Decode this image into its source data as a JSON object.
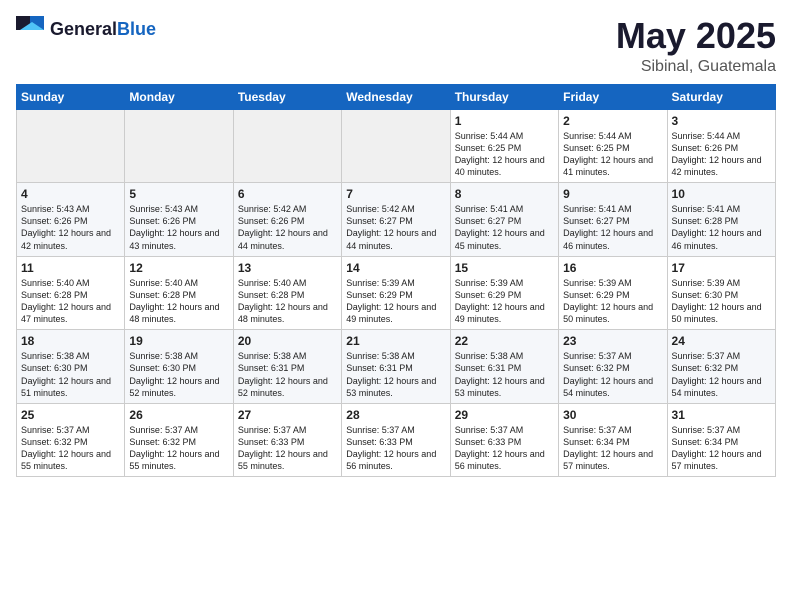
{
  "header": {
    "logo_general": "General",
    "logo_blue": "Blue",
    "month_title": "May 2025",
    "location": "Sibinal, Guatemala"
  },
  "weekdays": [
    "Sunday",
    "Monday",
    "Tuesday",
    "Wednesday",
    "Thursday",
    "Friday",
    "Saturday"
  ],
  "weeks": [
    [
      {
        "day": "",
        "sunrise": "",
        "sunset": "",
        "daylight": "",
        "empty": true
      },
      {
        "day": "",
        "sunrise": "",
        "sunset": "",
        "daylight": "",
        "empty": true
      },
      {
        "day": "",
        "sunrise": "",
        "sunset": "",
        "daylight": "",
        "empty": true
      },
      {
        "day": "",
        "sunrise": "",
        "sunset": "",
        "daylight": "",
        "empty": true
      },
      {
        "day": "1",
        "sunrise": "Sunrise: 5:44 AM",
        "sunset": "Sunset: 6:25 PM",
        "daylight": "Daylight: 12 hours and 40 minutes.",
        "empty": false
      },
      {
        "day": "2",
        "sunrise": "Sunrise: 5:44 AM",
        "sunset": "Sunset: 6:25 PM",
        "daylight": "Daylight: 12 hours and 41 minutes.",
        "empty": false
      },
      {
        "day": "3",
        "sunrise": "Sunrise: 5:44 AM",
        "sunset": "Sunset: 6:26 PM",
        "daylight": "Daylight: 12 hours and 42 minutes.",
        "empty": false
      }
    ],
    [
      {
        "day": "4",
        "sunrise": "Sunrise: 5:43 AM",
        "sunset": "Sunset: 6:26 PM",
        "daylight": "Daylight: 12 hours and 42 minutes.",
        "empty": false
      },
      {
        "day": "5",
        "sunrise": "Sunrise: 5:43 AM",
        "sunset": "Sunset: 6:26 PM",
        "daylight": "Daylight: 12 hours and 43 minutes.",
        "empty": false
      },
      {
        "day": "6",
        "sunrise": "Sunrise: 5:42 AM",
        "sunset": "Sunset: 6:26 PM",
        "daylight": "Daylight: 12 hours and 44 minutes.",
        "empty": false
      },
      {
        "day": "7",
        "sunrise": "Sunrise: 5:42 AM",
        "sunset": "Sunset: 6:27 PM",
        "daylight": "Daylight: 12 hours and 44 minutes.",
        "empty": false
      },
      {
        "day": "8",
        "sunrise": "Sunrise: 5:41 AM",
        "sunset": "Sunset: 6:27 PM",
        "daylight": "Daylight: 12 hours and 45 minutes.",
        "empty": false
      },
      {
        "day": "9",
        "sunrise": "Sunrise: 5:41 AM",
        "sunset": "Sunset: 6:27 PM",
        "daylight": "Daylight: 12 hours and 46 minutes.",
        "empty": false
      },
      {
        "day": "10",
        "sunrise": "Sunrise: 5:41 AM",
        "sunset": "Sunset: 6:28 PM",
        "daylight": "Daylight: 12 hours and 46 minutes.",
        "empty": false
      }
    ],
    [
      {
        "day": "11",
        "sunrise": "Sunrise: 5:40 AM",
        "sunset": "Sunset: 6:28 PM",
        "daylight": "Daylight: 12 hours and 47 minutes.",
        "empty": false
      },
      {
        "day": "12",
        "sunrise": "Sunrise: 5:40 AM",
        "sunset": "Sunset: 6:28 PM",
        "daylight": "Daylight: 12 hours and 48 minutes.",
        "empty": false
      },
      {
        "day": "13",
        "sunrise": "Sunrise: 5:40 AM",
        "sunset": "Sunset: 6:28 PM",
        "daylight": "Daylight: 12 hours and 48 minutes.",
        "empty": false
      },
      {
        "day": "14",
        "sunrise": "Sunrise: 5:39 AM",
        "sunset": "Sunset: 6:29 PM",
        "daylight": "Daylight: 12 hours and 49 minutes.",
        "empty": false
      },
      {
        "day": "15",
        "sunrise": "Sunrise: 5:39 AM",
        "sunset": "Sunset: 6:29 PM",
        "daylight": "Daylight: 12 hours and 49 minutes.",
        "empty": false
      },
      {
        "day": "16",
        "sunrise": "Sunrise: 5:39 AM",
        "sunset": "Sunset: 6:29 PM",
        "daylight": "Daylight: 12 hours and 50 minutes.",
        "empty": false
      },
      {
        "day": "17",
        "sunrise": "Sunrise: 5:39 AM",
        "sunset": "Sunset: 6:30 PM",
        "daylight": "Daylight: 12 hours and 50 minutes.",
        "empty": false
      }
    ],
    [
      {
        "day": "18",
        "sunrise": "Sunrise: 5:38 AM",
        "sunset": "Sunset: 6:30 PM",
        "daylight": "Daylight: 12 hours and 51 minutes.",
        "empty": false
      },
      {
        "day": "19",
        "sunrise": "Sunrise: 5:38 AM",
        "sunset": "Sunset: 6:30 PM",
        "daylight": "Daylight: 12 hours and 52 minutes.",
        "empty": false
      },
      {
        "day": "20",
        "sunrise": "Sunrise: 5:38 AM",
        "sunset": "Sunset: 6:31 PM",
        "daylight": "Daylight: 12 hours and 52 minutes.",
        "empty": false
      },
      {
        "day": "21",
        "sunrise": "Sunrise: 5:38 AM",
        "sunset": "Sunset: 6:31 PM",
        "daylight": "Daylight: 12 hours and 53 minutes.",
        "empty": false
      },
      {
        "day": "22",
        "sunrise": "Sunrise: 5:38 AM",
        "sunset": "Sunset: 6:31 PM",
        "daylight": "Daylight: 12 hours and 53 minutes.",
        "empty": false
      },
      {
        "day": "23",
        "sunrise": "Sunrise: 5:37 AM",
        "sunset": "Sunset: 6:32 PM",
        "daylight": "Daylight: 12 hours and 54 minutes.",
        "empty": false
      },
      {
        "day": "24",
        "sunrise": "Sunrise: 5:37 AM",
        "sunset": "Sunset: 6:32 PM",
        "daylight": "Daylight: 12 hours and 54 minutes.",
        "empty": false
      }
    ],
    [
      {
        "day": "25",
        "sunrise": "Sunrise: 5:37 AM",
        "sunset": "Sunset: 6:32 PM",
        "daylight": "Daylight: 12 hours and 55 minutes.",
        "empty": false
      },
      {
        "day": "26",
        "sunrise": "Sunrise: 5:37 AM",
        "sunset": "Sunset: 6:32 PM",
        "daylight": "Daylight: 12 hours and 55 minutes.",
        "empty": false
      },
      {
        "day": "27",
        "sunrise": "Sunrise: 5:37 AM",
        "sunset": "Sunset: 6:33 PM",
        "daylight": "Daylight: 12 hours and 55 minutes.",
        "empty": false
      },
      {
        "day": "28",
        "sunrise": "Sunrise: 5:37 AM",
        "sunset": "Sunset: 6:33 PM",
        "daylight": "Daylight: 12 hours and 56 minutes.",
        "empty": false
      },
      {
        "day": "29",
        "sunrise": "Sunrise: 5:37 AM",
        "sunset": "Sunset: 6:33 PM",
        "daylight": "Daylight: 12 hours and 56 minutes.",
        "empty": false
      },
      {
        "day": "30",
        "sunrise": "Sunrise: 5:37 AM",
        "sunset": "Sunset: 6:34 PM",
        "daylight": "Daylight: 12 hours and 57 minutes.",
        "empty": false
      },
      {
        "day": "31",
        "sunrise": "Sunrise: 5:37 AM",
        "sunset": "Sunset: 6:34 PM",
        "daylight": "Daylight: 12 hours and 57 minutes.",
        "empty": false
      }
    ]
  ]
}
